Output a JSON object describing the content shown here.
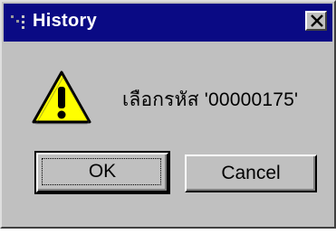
{
  "window": {
    "title": "History",
    "close_icon": "close-icon",
    "app_icon": "history-app-icon"
  },
  "message": {
    "icon": "warning-icon",
    "text": "เลือกรหัส '00000175'"
  },
  "buttons": {
    "ok_label": "OK",
    "cancel_label": "Cancel"
  },
  "colors": {
    "titlebar": "#0a0a84",
    "dialog_face": "#c0c0c0",
    "warning_fill": "#ffff00"
  }
}
